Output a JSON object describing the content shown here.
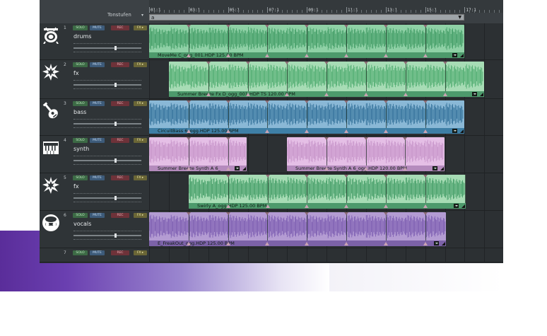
{
  "header": {
    "tonstufen_label": "Tonstufen",
    "loop_start": "a",
    "loop_end": "▼",
    "ruler": [
      "01:1",
      "03:1",
      "05:1",
      "07:1",
      "09:1",
      "11:1",
      "13:1",
      "15:1",
      "17:1"
    ]
  },
  "buttons": {
    "solo": "SOLO",
    "mute": "MUTE",
    "rec": "REC",
    "fx": "FX ▸"
  },
  "tracks": [
    {
      "number": "1",
      "name": "drums",
      "icon": "drum-icon",
      "volume": 0.6,
      "clips": [
        {
          "label": "MoveMe C_ogg_001.HDP  125.00 BPM",
          "color": "#8fd1a6",
          "bar": "#4d9a6c",
          "wave": "#3f9a63"
        }
      ]
    },
    {
      "number": "2",
      "name": "fx",
      "icon": "explosion-icon",
      "volume": 0.6,
      "clips": [
        {
          "label": "Summer Breeze Fx D_ogg_001.HDP  TS  120.00 BPM",
          "color": "#a7dcb5",
          "bar": "#4d9a6c",
          "wave": "#4caa6d"
        }
      ]
    },
    {
      "number": "3",
      "name": "bass",
      "icon": "guitar-icon",
      "volume": 0.6,
      "clips": [
        {
          "label": "CircuitBass 6_ogg.HDP  125.00 BPM",
          "color": "#8ab8d6",
          "bar": "#3e7fa6",
          "wave": "#2f6e97"
        }
      ]
    },
    {
      "number": "4",
      "name": "synth",
      "icon": "keyboard-icon",
      "volume": 0.6,
      "clips": [
        {
          "label": "Summer Breeze Synth A 6_",
          "color": "#e5bfe6",
          "bar": "#b58bbd",
          "wave": "#c693c8"
        },
        {
          "label": "Summer Breeze Synth A 6_ogg.HDP  120.00 BPM",
          "color": "#e5bfe6",
          "bar": "#b58bbd",
          "wave": "#c693c8"
        }
      ]
    },
    {
      "number": "5",
      "name": "fx",
      "icon": "explosion-icon",
      "volume": 0.6,
      "clips": [
        {
          "label": "Swirly A_ogg.HDP  125.00 BPM",
          "color": "#a7dcb5",
          "bar": "#4d9a6c",
          "wave": "#3f9a63"
        }
      ]
    },
    {
      "number": "6",
      "name": "vocals",
      "icon": "singer-icon",
      "volume": 0.6,
      "clips": [
        {
          "label": "E_FreakOut_ogg.HDP  125.00 BPM",
          "color": "#b49cd3",
          "bar": "#7c62a8",
          "wave": "#7a5bb0"
        }
      ]
    },
    {
      "number": "7",
      "name": "",
      "icon": "",
      "volume": 0.6,
      "clips": []
    }
  ],
  "colors": {
    "accent_green": "#8fd1a6",
    "background": "#2a2e31",
    "band_purple": "#5a2d9a"
  }
}
